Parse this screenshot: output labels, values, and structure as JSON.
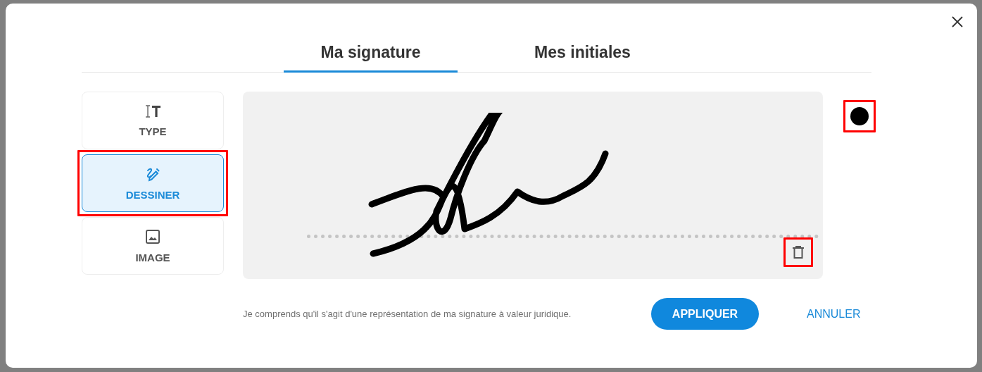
{
  "tabs": [
    {
      "label": "Ma signature",
      "selected": true
    },
    {
      "label": "Mes initiales",
      "selected": false
    }
  ],
  "modes": [
    {
      "kind": "type",
      "label": "TYPE",
      "selected": false,
      "highlighted": false
    },
    {
      "kind": "draw",
      "label": "DESSINER",
      "selected": true,
      "highlighted": true
    },
    {
      "kind": "image",
      "label": "IMAGE",
      "selected": false,
      "highlighted": false
    }
  ],
  "pen_color": {
    "color": "#000000",
    "highlighted": true
  },
  "clear_button": {
    "highlighted": true
  },
  "notice": "Je comprends qu'il s'agit d'une représentation de ma signature à valeur juridique.",
  "buttons": [
    {
      "kind": "primary",
      "label": "APPLIQUER"
    },
    {
      "kind": "text",
      "label": "ANNULER"
    }
  ]
}
